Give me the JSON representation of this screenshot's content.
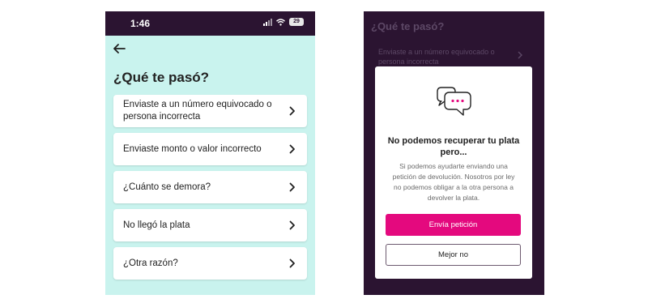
{
  "left_screen": {
    "status_bar": {
      "time": "1:46",
      "battery": "29"
    },
    "title": "¿Qué te pasó?",
    "options": [
      {
        "label": "Enviaste a un número equivocado o persona incorrecta"
      },
      {
        "label": "Enviaste monto o valor incorrecto"
      },
      {
        "label": "¿Cuánto se demora?"
      },
      {
        "label": "No llegó la plata"
      },
      {
        "label": "¿Otra razón?"
      }
    ]
  },
  "right_screen": {
    "background": {
      "title": "¿Qué te pasó?",
      "first_option": "Enviaste a un número equivocado o persona incorrecta"
    },
    "modal": {
      "title": "No podemos recuperar tu plata pero...",
      "body": "Si podemos ayudarte enviando una petición de devolución. Nosotros por ley no podemos obligar a la otra persona a devolver la plata.",
      "primary_button": "Envía petición",
      "secondary_button": "Mejor no"
    }
  },
  "colors": {
    "mint_background": "#c9f3ee",
    "dark_purple": "#2b1431",
    "magenta": "#e4097e"
  },
  "icons": [
    "back-arrow-icon",
    "chevron-right-icon",
    "signal-icon",
    "wifi-icon",
    "battery-icon",
    "chat-bubble-icon"
  ]
}
